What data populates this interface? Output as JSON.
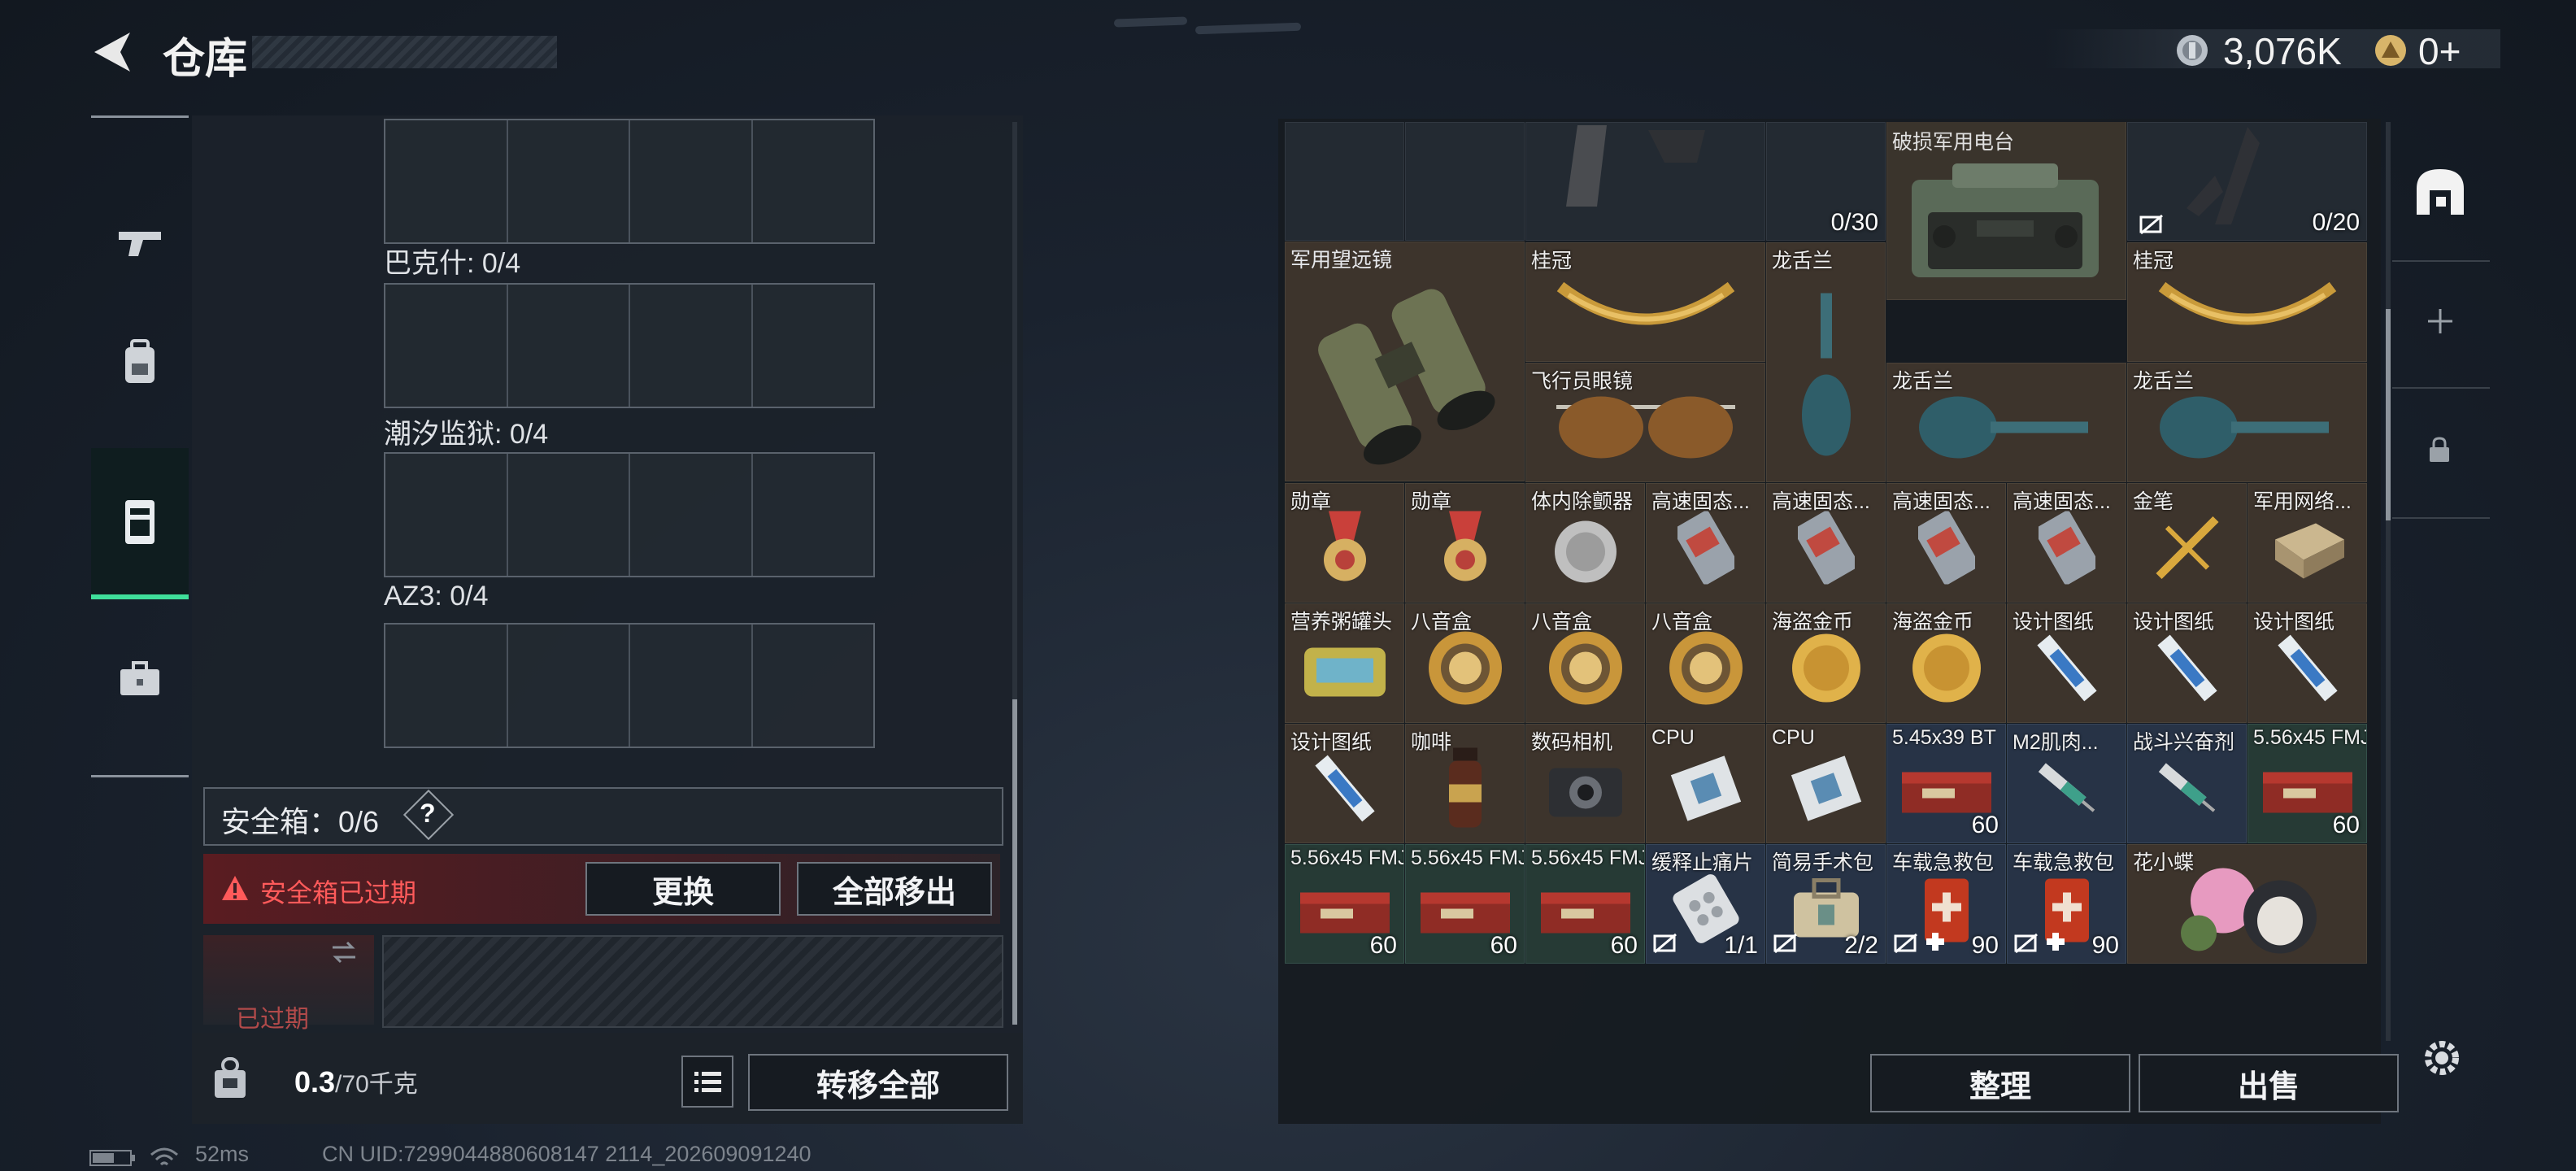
{
  "header": {
    "title": "仓库",
    "currency1": "3,076K",
    "currency2": "0+"
  },
  "left": {
    "sections": [
      {
        "label": "巴克什: 0/4"
      },
      {
        "label": "潮汐监狱: 0/4"
      },
      {
        "label": "AZ3: 0/4"
      }
    ],
    "safebox": {
      "label": "安全箱：0/6",
      "help": "?",
      "warning": "安全箱已过期",
      "replace_btn": "更换",
      "remove_all_btn": "全部移出",
      "expired": "已过期"
    },
    "weight_value": "0.3",
    "weight_unit": "/70千克",
    "transfer_all_btn": "转移全部"
  },
  "status": {
    "ping": "52ms",
    "uid": "CN UID:7299044880608147 2114_202609091240"
  },
  "right": {
    "sort_btn": "整理",
    "sell_btn": "出售",
    "top_counts": {
      "a": "0/30",
      "b": "0/20",
      "radio": "破损军用电台"
    },
    "binoculars": "军用望远镜",
    "items": [
      {
        "name": "桂冠"
      },
      {
        "name": "龙舌兰"
      },
      {
        "name": "桂冠"
      },
      {
        "name": "飞行员眼镜"
      },
      {
        "name": "龙舌兰"
      },
      {
        "name": "龙舌兰"
      },
      {
        "name": "勋章"
      },
      {
        "name": "勋章"
      },
      {
        "name": "体内除颤器"
      },
      {
        "name": "高速固态..."
      },
      {
        "name": "高速固态..."
      },
      {
        "name": "高速固态..."
      },
      {
        "name": "高速固态..."
      },
      {
        "name": "金笔"
      },
      {
        "name": "军用网络..."
      },
      {
        "name": "营养粥罐头"
      },
      {
        "name": "八音盒"
      },
      {
        "name": "八音盒"
      },
      {
        "name": "八音盒"
      },
      {
        "name": "海盗金币"
      },
      {
        "name": "海盗金币"
      },
      {
        "name": "设计图纸"
      },
      {
        "name": "设计图纸"
      },
      {
        "name": "设计图纸"
      },
      {
        "name": "设计图纸"
      },
      {
        "name": "咖啡"
      },
      {
        "name": "数码相机"
      },
      {
        "name": "CPU"
      },
      {
        "name": "CPU"
      },
      {
        "name": "5.45x39 BT",
        "count": "60"
      },
      {
        "name": "M2肌肉..."
      },
      {
        "name": "战斗兴奋剂"
      },
      {
        "name": "5.56x45 FMJ",
        "count": "60"
      },
      {
        "name": "5.56x45 FMJ",
        "count": "60"
      },
      {
        "name": "5.56x45 FMJ",
        "count": "60"
      },
      {
        "name": "5.56x45 FMJ",
        "count": "60"
      },
      {
        "name": "缓释止痛片",
        "count": "1/1"
      },
      {
        "name": "简易手术包",
        "count": "2/2"
      },
      {
        "name": "车载急救包",
        "count": "90"
      },
      {
        "name": "车载急救包",
        "count": "90"
      },
      {
        "name": "花小蝶"
      }
    ]
  },
  "colors": {
    "accent_green": "#3fdf9a",
    "warn_red": "#ff5a5a",
    "cell_brown": "#3d342c",
    "cell_blue": "#273346"
  }
}
